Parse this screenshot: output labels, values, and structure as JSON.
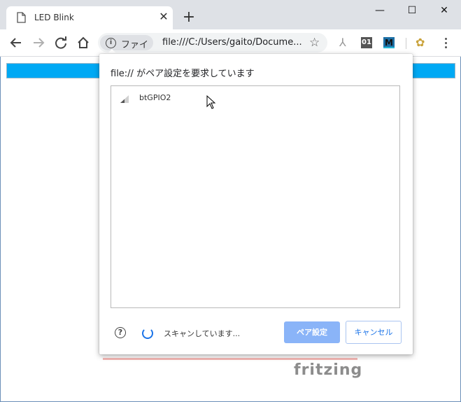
{
  "window": {
    "tab_title": "LED Blink",
    "tab_close": "✕",
    "new_tab": "+",
    "minimize": "—",
    "maximize": "☐",
    "close": "✕"
  },
  "toolbar": {
    "back_icon": "arrow-left-icon",
    "forward_icon": "arrow-right-icon",
    "reload_icon": "reload-icon",
    "home_icon": "home-icon",
    "info_chip_label": "ファイル",
    "url": "file:///C:/Users/gaito/Docume...",
    "star": "☆",
    "ext_01": "01",
    "ext_m": "M"
  },
  "dialog": {
    "title": "file:// がペア設定を要求しています",
    "devices": [
      {
        "name": "btGPIO2"
      }
    ],
    "help": "?",
    "status": "スキャンしています...",
    "pair_button": "ペア設定",
    "cancel_button": "キャンセル"
  },
  "page": {
    "logo_text": "fritzing"
  },
  "colors": {
    "page_bar": "#00a9f4",
    "pair_button_bg": "#8ab4f8",
    "accent": "#1a73e8"
  }
}
